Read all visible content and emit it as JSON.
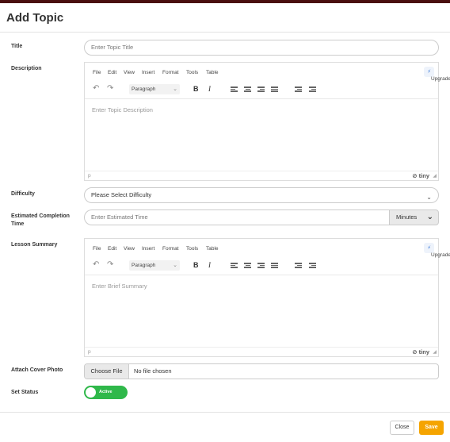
{
  "modal": {
    "title": "Add Topic",
    "close_label": "Close",
    "save_label": "Save"
  },
  "fields": {
    "title": {
      "label": "Title",
      "placeholder": "Enter Topic Title"
    },
    "description": {
      "label": "Description",
      "placeholder": "Enter Topic Description"
    },
    "difficulty": {
      "label": "Difficulty",
      "value": "Please Select Difficulty"
    },
    "estimated_time": {
      "label_line1": "Estimated Completion",
      "label_line2": "Time",
      "placeholder": "Enter Estimated Time",
      "unit": "Minutes"
    },
    "lesson_summary": {
      "label": "Lesson Summary",
      "placeholder": "Enter Brief Summary"
    },
    "cover_photo": {
      "label": "Attach Cover Photo",
      "button": "Choose File",
      "file_name": "No file chosen"
    },
    "status": {
      "label": "Set Status",
      "value": "Active",
      "on": true,
      "color": "#2fb84a"
    }
  },
  "editor": {
    "menu": [
      "File",
      "Edit",
      "View",
      "Insert",
      "Format",
      "Tools",
      "Table"
    ],
    "upgrade": "Upgrade",
    "block_format": "Paragraph",
    "bold": "B",
    "italic": "I",
    "status_path": "p",
    "brand": "tiny"
  },
  "colors": {
    "accent": "#f5a400",
    "toggle_on": "#2fb84a",
    "top_bar": "#4a0f0f"
  }
}
